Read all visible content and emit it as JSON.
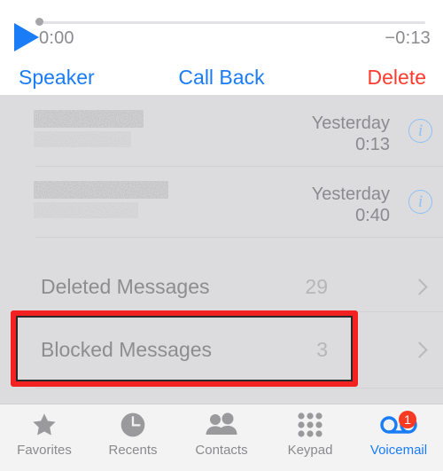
{
  "player": {
    "play_icon": "play-triangle-icon",
    "elapsed": "0:00",
    "remaining": "−0:13",
    "progress_percent": 0,
    "accent_color": "#1a7cf7"
  },
  "actions": {
    "speaker_label": "Speaker",
    "call_back_label": "Call Back",
    "delete_label": "Delete",
    "delete_color": "#ff3b2f"
  },
  "voicemails": [
    {
      "sender": "",
      "sender_redacted": true,
      "subtitle_redacted": true,
      "date": "Yesterday",
      "duration": "0:13",
      "info_icon": "info-circle-icon"
    },
    {
      "sender": "",
      "sender_redacted": true,
      "subtitle_redacted": true,
      "date": "Yesterday",
      "duration": "0:40",
      "info_icon": "info-circle-icon"
    }
  ],
  "folders": [
    {
      "label": "Deleted Messages",
      "count": "29",
      "chevron": "chevron-right-icon",
      "highlighted": false
    },
    {
      "label": "Blocked Messages",
      "count": "3",
      "chevron": "chevron-right-icon",
      "highlighted": true
    }
  ],
  "annotation": {
    "target": "Blocked Messages",
    "color": "#f32121"
  },
  "tabbar": {
    "items": [
      {
        "label": "Favorites",
        "icon": "star-icon",
        "active": false,
        "badge": ""
      },
      {
        "label": "Recents",
        "icon": "clock-icon",
        "active": false,
        "badge": ""
      },
      {
        "label": "Contacts",
        "icon": "people-icon",
        "active": false,
        "badge": ""
      },
      {
        "label": "Keypad",
        "icon": "keypad-dots-icon",
        "active": false,
        "badge": ""
      },
      {
        "label": "Voicemail",
        "icon": "voicemail-tape-icon",
        "active": true,
        "badge": "1"
      }
    ]
  }
}
